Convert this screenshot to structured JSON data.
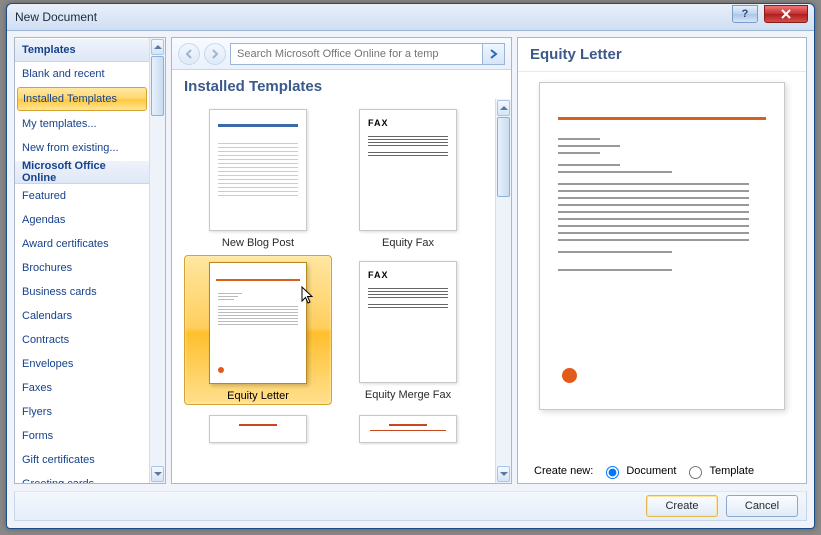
{
  "window": {
    "title": "New Document"
  },
  "sidebar": {
    "header1": "Templates",
    "items1": [
      "Blank and recent",
      "Installed Templates",
      "My templates...",
      "New from existing..."
    ],
    "selected1_index": 1,
    "header2": "Microsoft Office Online",
    "items2": [
      "Featured",
      "Agendas",
      "Award certificates",
      "Brochures",
      "Business cards",
      "Calendars",
      "Contracts",
      "Envelopes",
      "Faxes",
      "Flyers",
      "Forms",
      "Gift certificates",
      "Greeting cards"
    ]
  },
  "search": {
    "placeholder": "Search Microsoft Office Online for a temp"
  },
  "gallery": {
    "title": "Installed Templates",
    "items": [
      {
        "label": "New Blog Post",
        "kind": "blog",
        "selected": false
      },
      {
        "label": "Equity Fax",
        "kind": "fax",
        "selected": false
      },
      {
        "label": "Equity Letter",
        "kind": "equity-letter",
        "selected": true
      },
      {
        "label": "Equity Merge Fax",
        "kind": "fax",
        "selected": false
      },
      {
        "label": "",
        "kind": "partial-equity",
        "selected": false
      },
      {
        "label": "",
        "kind": "partial-equity",
        "selected": false
      }
    ],
    "fax_label": "FAX"
  },
  "preview": {
    "title": "Equity Letter",
    "create_label": "Create new:",
    "radio_doc": "Document",
    "radio_tmpl": "Template"
  },
  "footer": {
    "create": "Create",
    "cancel": "Cancel"
  },
  "help_glyph": "?"
}
